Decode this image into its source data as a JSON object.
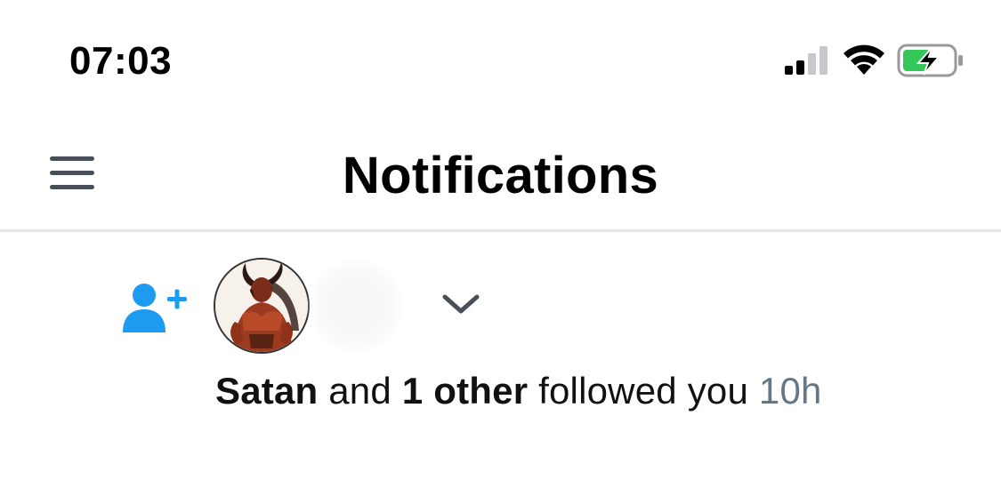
{
  "status_bar": {
    "time": "07:03",
    "icons": [
      "cellular-signal-icon",
      "wifi-icon",
      "battery-charging-icon"
    ]
  },
  "header": {
    "title": "Notifications",
    "menu_icon": "hamburger-menu-icon"
  },
  "notification": {
    "icon": "follow-user-plus-icon",
    "user_name": "Satan",
    "connector": "and",
    "others": "1 other",
    "action": "followed you",
    "time": "10h",
    "expand_icon": "chevron-down-icon"
  },
  "colors": {
    "accent": "#1d9bf0",
    "secondary_text": "#657786",
    "divider": "#e6e6ea",
    "battery_fill": "#34c759"
  }
}
